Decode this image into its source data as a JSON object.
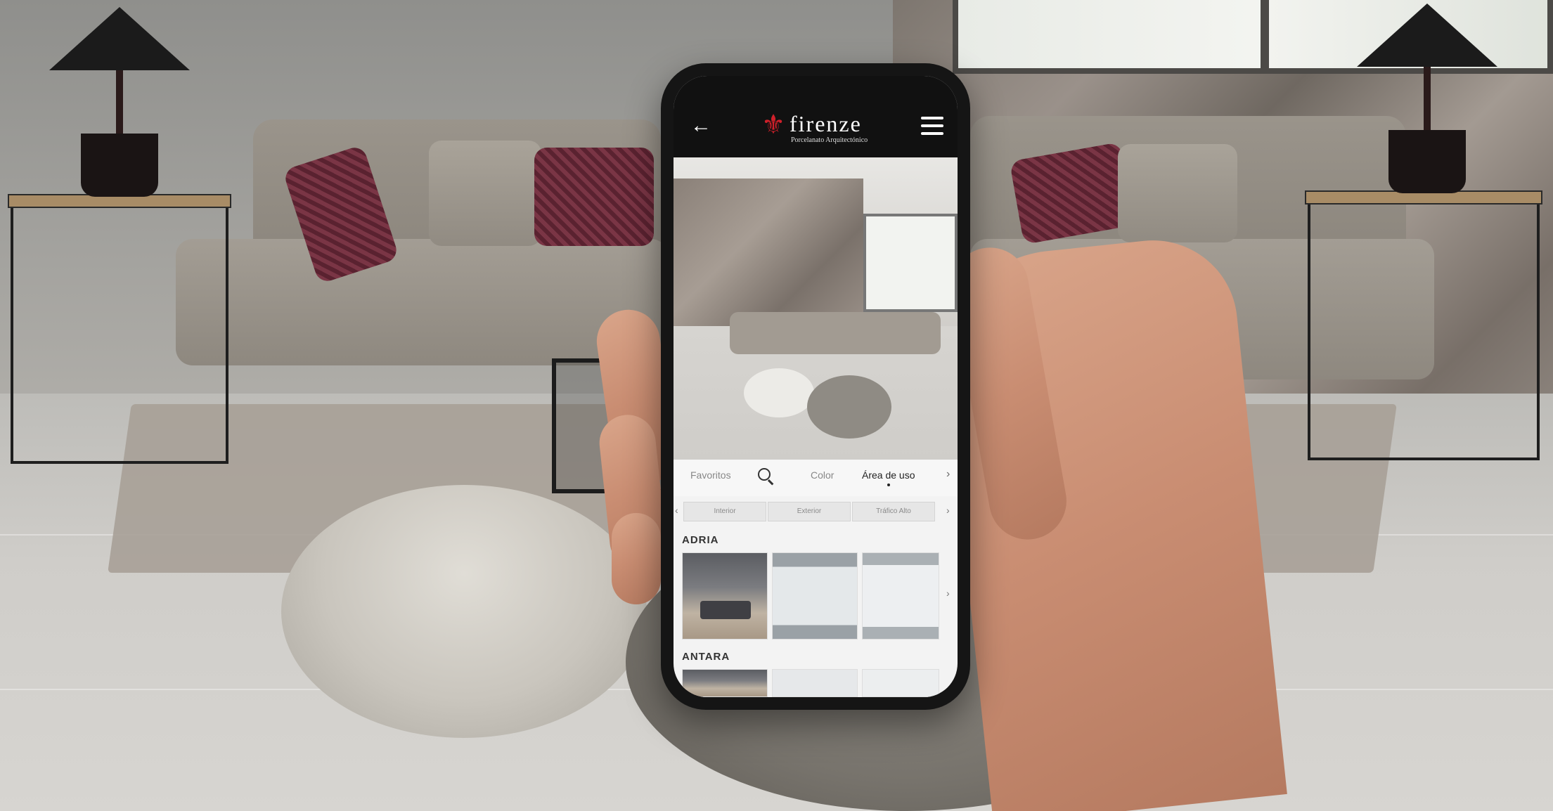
{
  "app": {
    "brand": "firenze",
    "tagline": "Porcelanato Arquitectónico",
    "back_icon": "back-arrow-icon",
    "menu_icon": "hamburger-menu-icon",
    "colors": {
      "header_bg": "#111111",
      "brand_red": "#d0202a"
    }
  },
  "tabs": {
    "items": [
      "Favoritos",
      "Color",
      "Área de uso"
    ],
    "active": "Área de uso",
    "search_icon": "search-icon",
    "next_symbol": "›"
  },
  "filters": {
    "chips": [
      "Interior",
      "Exterior",
      "Tráfico Alto"
    ],
    "prev_symbol": "‹",
    "next_symbol": "›"
  },
  "collections": [
    {
      "name": "ADRIA",
      "next_symbol": "›"
    },
    {
      "name": "ANTARA"
    }
  ]
}
